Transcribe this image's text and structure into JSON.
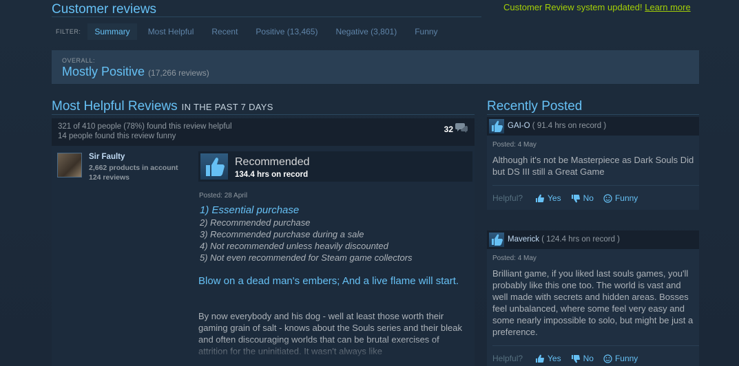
{
  "header": {
    "title": "Customer reviews",
    "notice_text": "Customer Review system updated!",
    "notice_link": "Learn more"
  },
  "filter": {
    "label": "FILTER:",
    "tabs": [
      {
        "label": "Summary",
        "active": true
      },
      {
        "label": "Most Helpful"
      },
      {
        "label": "Recent"
      },
      {
        "label": "Positive (13,465)"
      },
      {
        "label": "Negative (3,801)"
      },
      {
        "label": "Funny"
      }
    ]
  },
  "overall": {
    "label": "OVERALL:",
    "rating": "Mostly Positive",
    "count": "(17,266 reviews)"
  },
  "most_helpful": {
    "title": "Most Helpful Reviews",
    "subtitle": "IN THE PAST 7 DAYS",
    "review": {
      "helpful_text": "321 of 410 people (78%) found this review helpful",
      "funny_text": "14 people found this review funny",
      "comment_count": "32",
      "author": "Sir Faulty",
      "products": "2,662 products in account",
      "reviews": "124 reviews",
      "verdict": "Recommended",
      "hours": "134.4 hrs on record",
      "posted": "Posted: 28 April",
      "list": [
        "1) Essential purchase",
        "2) Recommended purchase",
        "3) Recommended purchase during a sale",
        "4) Not recommended unless heavily discounted",
        "5) Not even recommended for Steam game collectors"
      ],
      "quote": "Blow on a dead man's embers; And a live flame will start.",
      "body": "By now everybody and his dog - well at least those worth their gaming grain of salt - knows about the Souls series and their bleak and often discouraging worlds that can be brutal exercises of attrition for the uninitiated. It wasn't always like"
    }
  },
  "recently_posted": {
    "title": "Recently Posted",
    "helpful_label": "Helpful?",
    "yes_label": "Yes",
    "no_label": "No",
    "funny_label": "Funny",
    "reviews": [
      {
        "author": "GAI-O",
        "hours": "( 91.4 hrs on record )",
        "posted": "Posted: 4 May",
        "text": "Although it's not be Masterpiece as Dark Souls Did but DS III still a Great Game"
      },
      {
        "author": "Maverick",
        "hours": "( 124.4 hrs on record )",
        "posted": "Posted: 4 May",
        "text": "Brilliant game, if you liked last souls games, you'll probably like this one too. The world is vast and well made with secrets and hidden areas. Bosses feel unbalanced, where some feel very easy and some nearly impossible to solo, but might be just a preference."
      }
    ]
  },
  "colors": {
    "background": "#1b2838",
    "accent": "#66c0f4",
    "notice": "#a4d007"
  }
}
